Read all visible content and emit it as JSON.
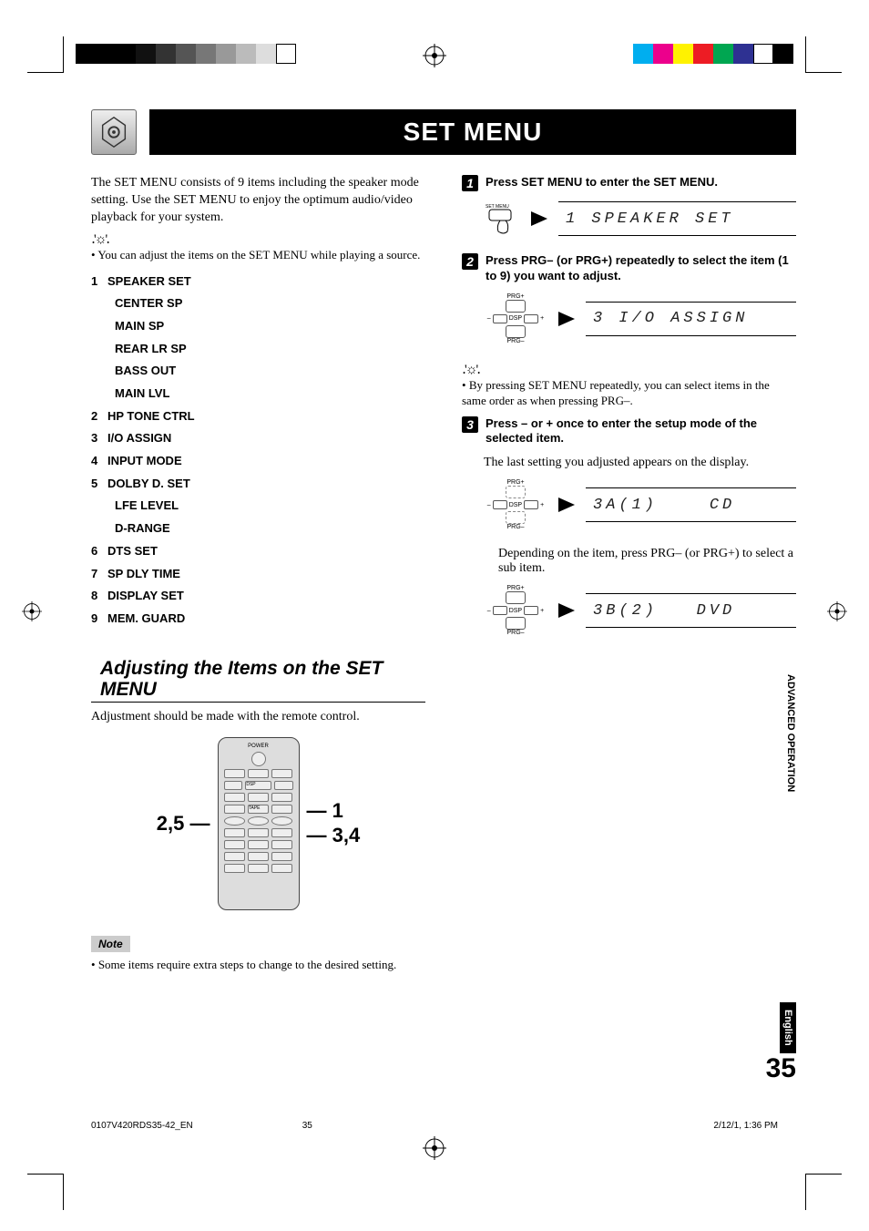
{
  "title": "SET MENU",
  "intro": "The SET MENU consists of 9 items including the speaker mode setting. Use the SET MENU to enjoy the optimum audio/video playback for your system.",
  "tip_left": "You can adjust the items on the SET MENU while playing a source.",
  "menu": [
    {
      "n": "1",
      "label": "SPEAKER SET",
      "subs": [
        "CENTER SP",
        "MAIN SP",
        "REAR LR SP",
        "BASS OUT",
        "MAIN LVL"
      ]
    },
    {
      "n": "2",
      "label": "HP TONE CTRL"
    },
    {
      "n": "3",
      "label": "I/O ASSIGN"
    },
    {
      "n": "4",
      "label": "INPUT MODE"
    },
    {
      "n": "5",
      "label": "DOLBY D. SET",
      "subs": [
        "LFE LEVEL",
        "D-RANGE"
      ]
    },
    {
      "n": "6",
      "label": "DTS SET"
    },
    {
      "n": "7",
      "label": "SP DLY TIME"
    },
    {
      "n": "8",
      "label": "DISPLAY SET"
    },
    {
      "n": "9",
      "label": "MEM. GUARD"
    }
  ],
  "adjust_heading": "Adjusting the Items on the SET MENU",
  "adjust_intro": "Adjustment should be made with the remote control.",
  "remote_left_label": "2,5",
  "remote_right_label_1": "1",
  "remote_right_label_2": "3,4",
  "note_label": "Note",
  "note_text": "Some items require extra steps to change to the desired setting.",
  "steps": {
    "s1": {
      "text": "Press SET MENU to enter the SET MENU.",
      "lcd": "1 SPEAKER SET"
    },
    "s2": {
      "text": "Press PRG– (or PRG+) repeatedly to select the item (1 to 9) you want to adjust.",
      "lcd": "3 I/O ASSIGN"
    },
    "tip": "By pressing SET MENU repeatedly, you can select items in the same order as when pressing PRG–.",
    "s3": {
      "text": "Press – or + once to enter the setup mode of the selected item.",
      "body": "The last setting you adjusted appears on the display.",
      "lcd": "3A(1)    CD"
    },
    "s3b": {
      "body": "Depending on the item, press PRG– (or PRG+) to select a sub item.",
      "lcd": "3B(2)   DVD"
    }
  },
  "side_operation": "ADVANCED OPERATION",
  "side_english": "English",
  "page_number": "35",
  "footer": {
    "file": "0107V420RDS35-42_EN",
    "page": "35",
    "ts": "2/12/1, 1:36 PM"
  }
}
